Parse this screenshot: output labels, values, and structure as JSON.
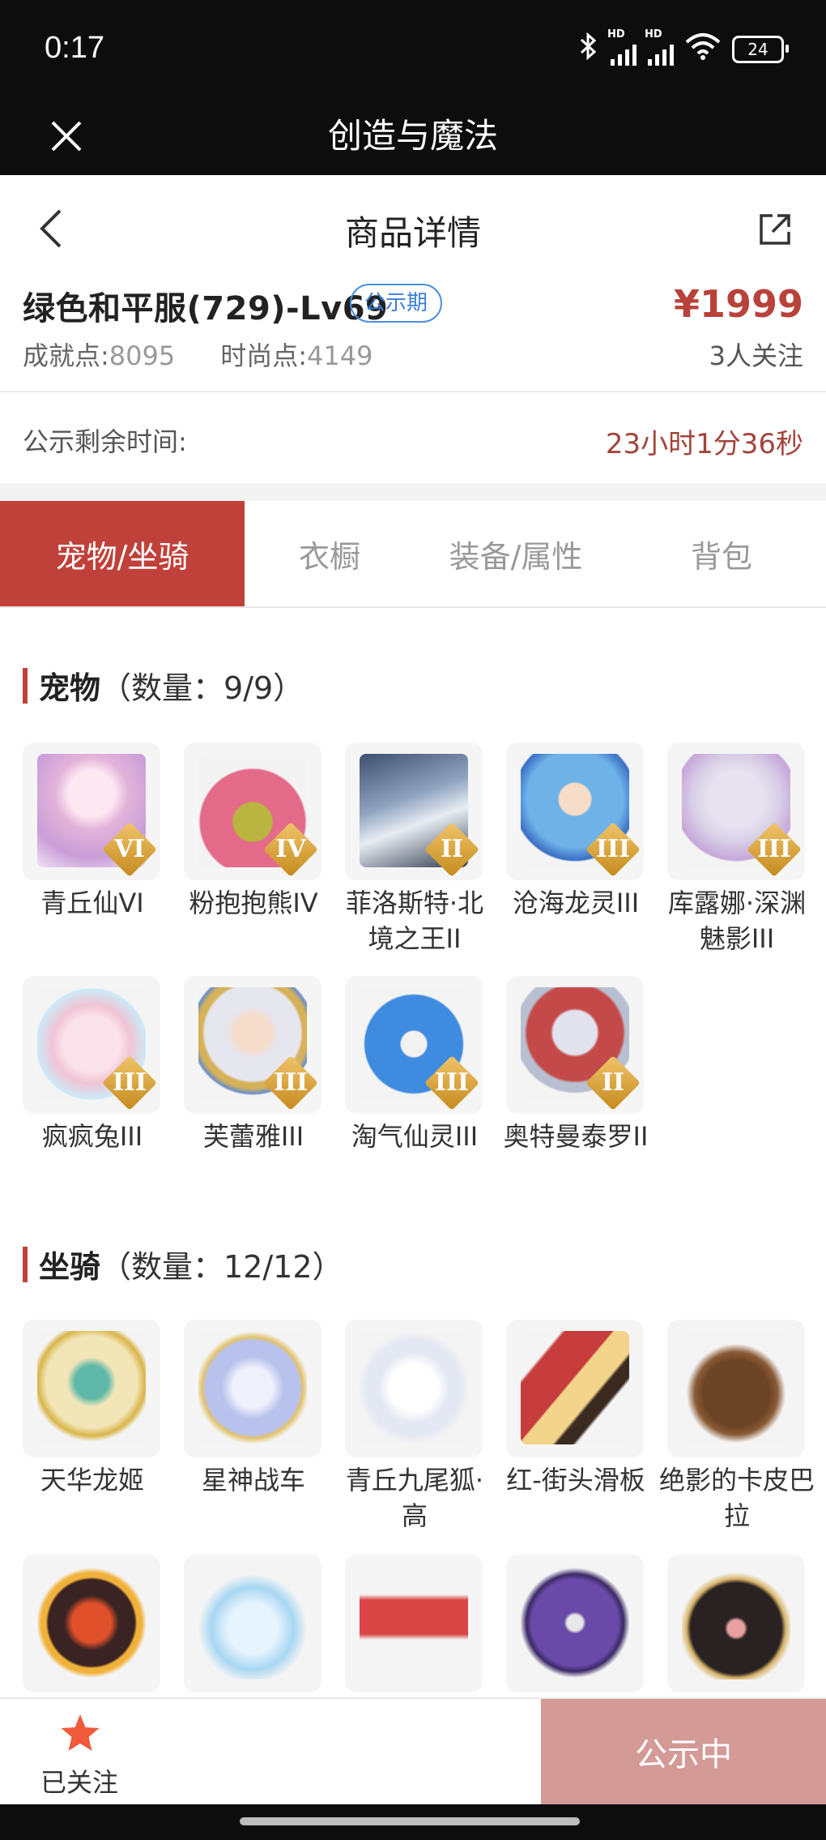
{
  "status_bar": {
    "time": "0:17",
    "battery": "24"
  },
  "app_bar": {
    "title": "创造与魔法"
  },
  "page_header": {
    "title": "商品详情"
  },
  "product": {
    "name": "绿色和平服(729)-Lv69",
    "badge": "公示期",
    "price": "¥1999",
    "followers": "3人关注",
    "achievement_label": "成就点:",
    "achievement_value": "8095",
    "fashion_label": "时尚点:",
    "fashion_value": "4149",
    "countdown_label": "公示剩余时间:",
    "countdown_value": "23小时1分36秒"
  },
  "tabs": [
    {
      "label": "宠物/坐骑",
      "active": true
    },
    {
      "label": "衣橱"
    },
    {
      "label": "装备/属性"
    },
    {
      "label": "背包"
    }
  ],
  "pets_section": {
    "title": "宠物",
    "count": "（数量：9/9）"
  },
  "pets": [
    {
      "name": "青丘仙VI",
      "rank": "VI"
    },
    {
      "name": "粉抱抱熊IV",
      "rank": "IV"
    },
    {
      "name": "菲洛斯特·北境之王II",
      "rank": "II"
    },
    {
      "name": "沧海龙灵III",
      "rank": "III"
    },
    {
      "name": "库露娜·深渊魅影III",
      "rank": "III"
    },
    {
      "name": "疯疯兔III",
      "rank": "III"
    },
    {
      "name": "芙蕾雅III",
      "rank": "III"
    },
    {
      "name": "淘气仙灵III",
      "rank": "III"
    },
    {
      "name": "奥特曼泰罗II",
      "rank": "II"
    }
  ],
  "mounts_section": {
    "title": "坐骑",
    "count": "（数量：12/12）"
  },
  "mounts": [
    {
      "name": "天华龙姬"
    },
    {
      "name": "星神战车"
    },
    {
      "name": "青丘九尾狐·高"
    },
    {
      "name": "红-街头滑板"
    },
    {
      "name": "绝影的卡皮巴拉"
    },
    {
      "name": ""
    },
    {
      "name": ""
    },
    {
      "name": ""
    },
    {
      "name": ""
    },
    {
      "name": ""
    }
  ],
  "bottom_bar": {
    "follow_label": "已关注",
    "status_label": "公示中"
  },
  "colors": {
    "accent": "#c0413a",
    "price": "#b8423a",
    "status_button": "#d39a96",
    "badge": "#3a7fd8"
  }
}
